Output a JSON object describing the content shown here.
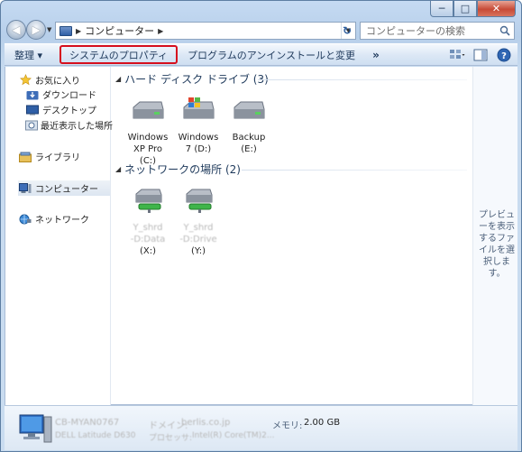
{
  "window": {
    "controls": {
      "minimize": "─",
      "maximize": "□",
      "close": "✕"
    }
  },
  "address": {
    "path": "コンピューター",
    "search_placeholder": "コンピューターの検索"
  },
  "toolbar": {
    "organize": "整理 ▾",
    "system_properties": "システムのプロパティ",
    "uninstall": "プログラムのアンインストールと変更",
    "more": "»"
  },
  "nav": {
    "favorites": "お気に入り",
    "downloads": "ダウンロード",
    "desktop": "デスクトップ",
    "recent": "最近表示した場所",
    "libraries": "ライブラリ",
    "computer": "コンピューター",
    "network": "ネットワーク"
  },
  "groups": {
    "hdd": "ハード ディスク ドライブ (3)",
    "network": "ネットワークの場所 (2)"
  },
  "drives": [
    {
      "line1": "Windows",
      "line2": "XP Pro",
      "line3": "(C:)"
    },
    {
      "line1": "Windows",
      "line2": "7 (D:)",
      "line3": ""
    },
    {
      "line1": "Backup",
      "line2": "(E:)",
      "line3": ""
    }
  ],
  "network_drives": [
    {
      "line1": "Y_shrd",
      "line2": "-D:Data",
      "line3": "(X:)"
    },
    {
      "line1": "Y_shrd",
      "line2": "-D:Drive",
      "line3": "(Y:)"
    }
  ],
  "preview": {
    "message": "プレビューを表示するファイルを選択します。"
  },
  "details": {
    "name": "CB-MYAN0767",
    "domain_label": "ドメイン:",
    "domain_value": "berlis.co.jp",
    "memory_label": "メモリ:",
    "memory_value": "2.00 GB",
    "model": "DELL Latitude D630",
    "processor_label": "プロセッサ:",
    "processor_value": "Intel(R) Core(TM)2..."
  },
  "colors": {
    "highlight_border": "#d60f1e",
    "accent": "#1e395b"
  }
}
